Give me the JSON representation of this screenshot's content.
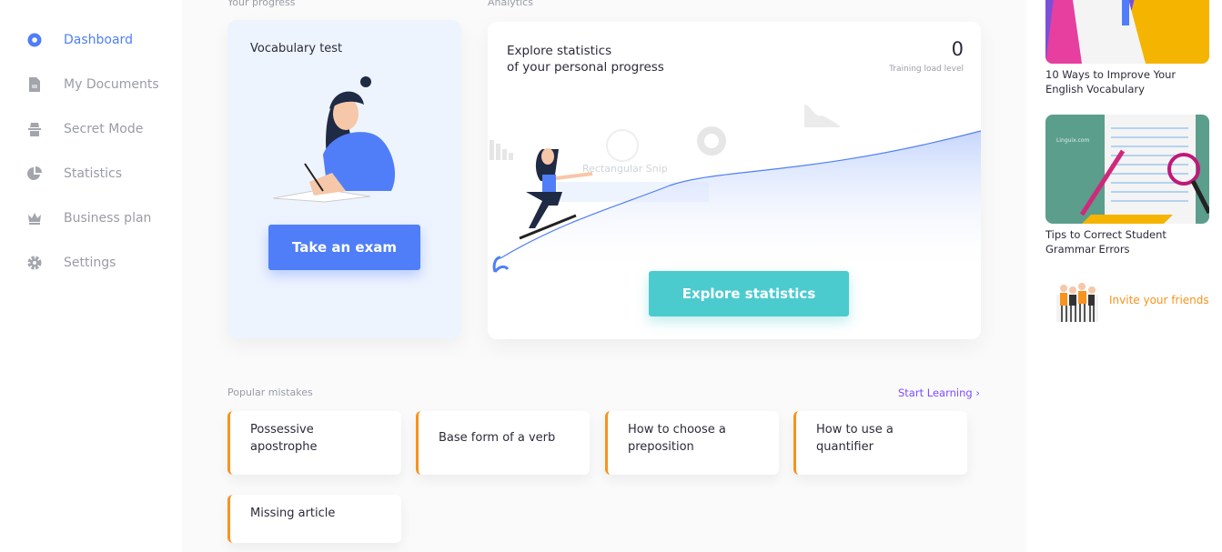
{
  "sidebar": {
    "items": [
      {
        "label": "Dashboard",
        "icon": "dashboard-circle-icon",
        "active": true
      },
      {
        "label": "My Documents",
        "icon": "document-icon"
      },
      {
        "label": "Secret Mode",
        "icon": "incognito-icon"
      },
      {
        "label": "Statistics",
        "icon": "pie-chart-icon"
      },
      {
        "label": "Business plan",
        "icon": "crown-icon"
      },
      {
        "label": "Settings",
        "icon": "gear-icon"
      }
    ]
  },
  "progress": {
    "section_label": "Your progress",
    "card_title": "Vocabulary test",
    "button": "Take an exam"
  },
  "analytics": {
    "section_label": "Analytics",
    "title_line1": "Explore statistics",
    "title_line2": "of your personal progress",
    "value": "0",
    "value_label": "Training load level",
    "overlay_text": "Rectangular Snip",
    "button": "Explore statistics"
  },
  "mistakes": {
    "section_label": "Popular mistakes",
    "link": "Start Learning ›",
    "items": [
      "Possessive apostrophe",
      "Base form of a verb",
      "How to choose a preposition",
      "How to use a quantifier",
      "Missing article"
    ]
  },
  "articles": [
    {
      "title": "10 Ways to Improve Your English Vocabulary"
    },
    {
      "title": "Tips to Correct Student Grammar Errors",
      "logo_text": "Linguix.com"
    }
  ],
  "invite": {
    "label": "Invite your friends"
  },
  "colors": {
    "accent": "#4f7ef8",
    "teal": "#4ccbcf",
    "orange": "#f7931e",
    "link": "#7c4dff"
  }
}
